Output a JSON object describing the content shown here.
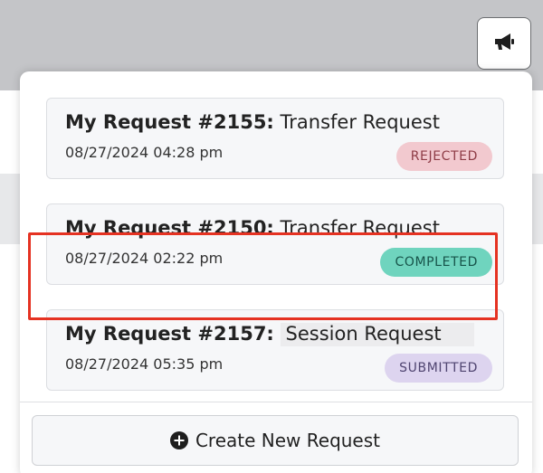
{
  "notification_button": {
    "icon": "megaphone-icon"
  },
  "requests": [
    {
      "number": "My Request #2155:",
      "type": "Transfer Request",
      "date": "08/27/2024 04:28 pm",
      "status": "REJECTED",
      "status_bg": "#f2c9cf",
      "status_fg": "#8e3c46"
    },
    {
      "number": "My Request #2150:",
      "type": "Transfer Request",
      "date": "08/27/2024 02:22 pm",
      "status": "COMPLETED",
      "status_bg": "#6fd4be",
      "status_fg": "#17544a"
    },
    {
      "number": "My Request #2157:",
      "type": "Session Request",
      "date": "08/27/2024 05:35 pm",
      "status": "SUBMITTED",
      "status_bg": "#ddd4ef",
      "status_fg": "#4f4470"
    }
  ],
  "create_button": {
    "label": "Create New Request",
    "icon": "plus-circle-icon"
  },
  "highlight_color": "#e53222"
}
